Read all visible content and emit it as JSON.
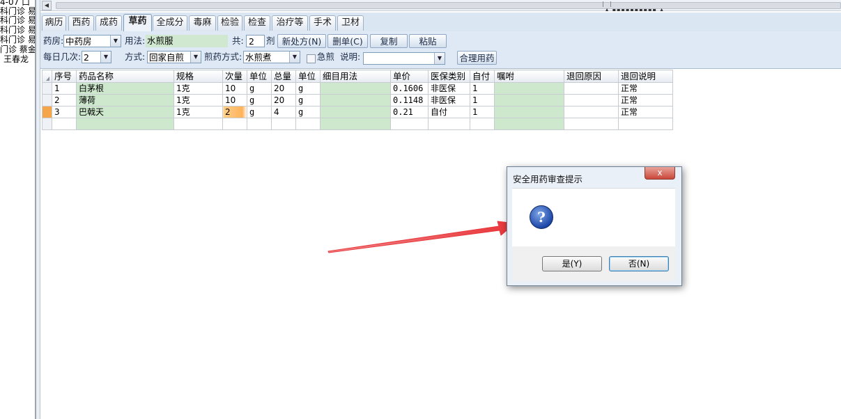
{
  "left_list": [
    "4-07 口",
    "科门诊 易",
    "科门诊 易",
    "科门诊 易",
    "科门诊 易",
    "门诊 蔡金",
    "王春龙"
  ],
  "tabs": [
    "病历",
    "西药",
    "成药",
    "草药",
    "全成分",
    "毒麻",
    "检验",
    "检查",
    "治疗等",
    "手术",
    "卫材"
  ],
  "active_tab": "草药",
  "toolbar": {
    "pharmacy_label": "药房:",
    "pharmacy_value": "中药房",
    "usage_label": "用法:",
    "usage_value": "水煎服",
    "total_label": "共:",
    "total_value": "2",
    "dose_unit": "剂",
    "new_rx_button": "新处方(N)",
    "delete_button": "删单(C)",
    "copy_button": "复制",
    "paste_button": "粘贴",
    "daily_times_label": "每日几次:",
    "daily_times_value": "2",
    "method_label": "方式:",
    "method_value": "回家自煎",
    "decoct_label": "煎药方式:",
    "decoct_value": "水煎煮",
    "urgent_label": "急煎",
    "note_label": "说明:",
    "note_value": "",
    "rational_button": "合理用药"
  },
  "grid": {
    "headers": [
      "序号",
      "药品名称",
      "规格",
      "次量",
      "单位",
      "总量",
      "单位",
      "细目用法",
      "单价",
      "医保类别",
      "自付",
      "嘱咐",
      "退回原因",
      "退回说明"
    ],
    "rows": [
      [
        "1",
        "白茅根",
        "1克",
        "10",
        "g",
        "20",
        "g",
        "",
        "0.1606",
        "非医保",
        "1",
        "",
        "",
        "正常"
      ],
      [
        "2",
        "薄荷",
        "1克",
        "10",
        "g",
        "20",
        "g",
        "",
        "0.1148",
        "非医保",
        "1",
        "",
        "",
        "正常"
      ],
      [
        "3",
        "巴戟天",
        "1克",
        "2",
        "g",
        "4",
        "g",
        "",
        "0.21",
        "自付",
        "1",
        "",
        "",
        "正常"
      ],
      [
        "",
        "",
        "",
        "",
        "",
        "",
        "",
        "",
        "",
        "",
        "",
        "",
        "",
        ""
      ]
    ]
  },
  "dialog": {
    "title": "安全用药审查提示",
    "close_glyph": "x",
    "icon": "question-icon",
    "icon_glyph": "?",
    "message": "",
    "yes_button": "是(Y)",
    "no_button": "否(N)"
  },
  "colors": {
    "annotation_arrow": "#e8363a",
    "editable_cell": "#cde8cd",
    "current_row_marker": "#f5a54a",
    "toolbar_bg": "#dfe9f5"
  }
}
